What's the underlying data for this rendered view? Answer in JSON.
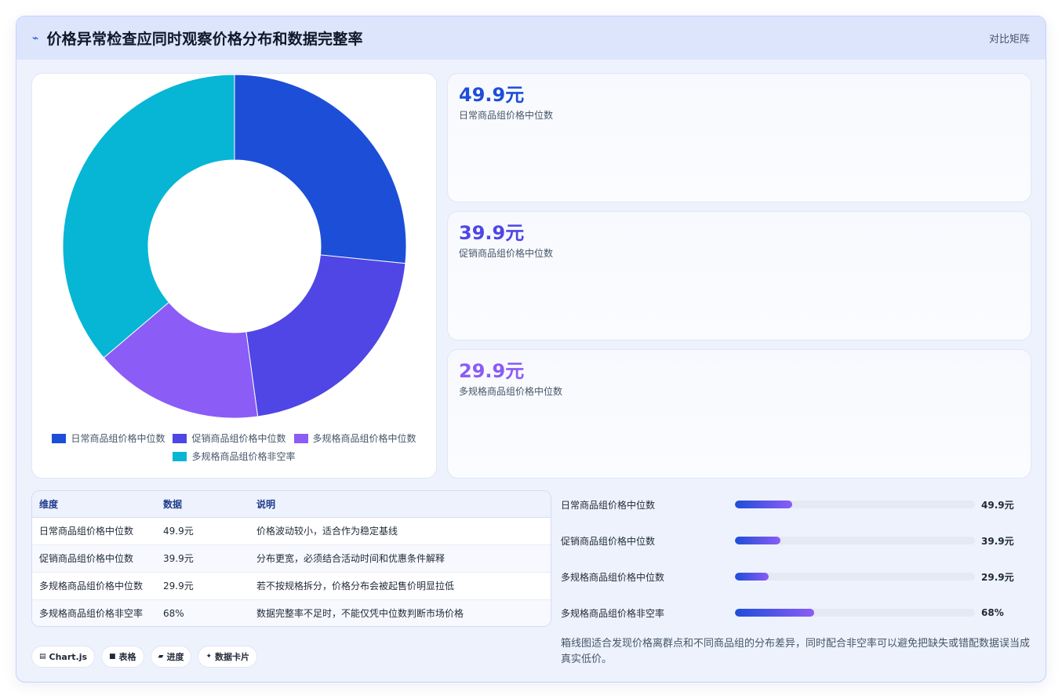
{
  "header": {
    "icon": "chart-line-icon",
    "title": "价格异常检查应同时观察价格分布和数据完整率",
    "right_label": "对比矩阵"
  },
  "chart_data": {
    "type": "pie",
    "categories": [
      "日常商品组价格中位数",
      "促销商品组价格中位数",
      "多规格商品组价格中位数",
      "多规格商品组价格非空率"
    ],
    "values": [
      49.9,
      39.9,
      29.9,
      68
    ],
    "colors": [
      "#1d4ed8",
      "#4f46e5",
      "#8b5cf6",
      "#06b6d4"
    ],
    "title": "",
    "donut": true,
    "legend_position": "bottom"
  },
  "stats": [
    {
      "value": "49.9元",
      "label": "日常商品组价格中位数",
      "color": "#1d4ed8"
    },
    {
      "value": "39.9元",
      "label": "促销商品组价格中位数",
      "color": "#4f46e5"
    },
    {
      "value": "29.9元",
      "label": "多规格商品组价格中位数",
      "color": "#8b5cf6"
    }
  ],
  "table": {
    "headers": [
      "维度",
      "数据",
      "说明"
    ],
    "rows": [
      [
        "日常商品组价格中位数",
        "49.9元",
        "价格波动较小，适合作为稳定基线"
      ],
      [
        "促销商品组价格中位数",
        "39.9元",
        "分布更宽，必须结合活动时间和优惠条件解释"
      ],
      [
        "多规格商品组价格中位数",
        "29.9元",
        "若不按规格拆分，价格分布会被起售价明显拉低"
      ],
      [
        "多规格商品组价格非空率",
        "68%",
        "数据完整率不足时，不能仅凭中位数判断市场价格"
      ]
    ]
  },
  "progress": [
    {
      "label": "日常商品组价格中位数",
      "value": "49.9元",
      "fraction": 0.24
    },
    {
      "label": "促销商品组价格中位数",
      "value": "39.9元",
      "fraction": 0.19
    },
    {
      "label": "多规格商品组价格中位数",
      "value": "29.9元",
      "fraction": 0.14
    },
    {
      "label": "多规格商品组价格非空率",
      "value": "68%",
      "fraction": 0.33
    }
  ],
  "note": "箱线图适合发现价格离群点和不同商品组的分布差异，同时配合非空率可以避免把缺失或错配数据误当成真实低价。",
  "chips": [
    {
      "icon": "chart-icon",
      "label": "Chart.js"
    },
    {
      "icon": "table-icon",
      "label": "表格"
    },
    {
      "icon": "progress-icon",
      "label": "进度"
    },
    {
      "icon": "card-icon",
      "label": "数据卡片"
    }
  ]
}
